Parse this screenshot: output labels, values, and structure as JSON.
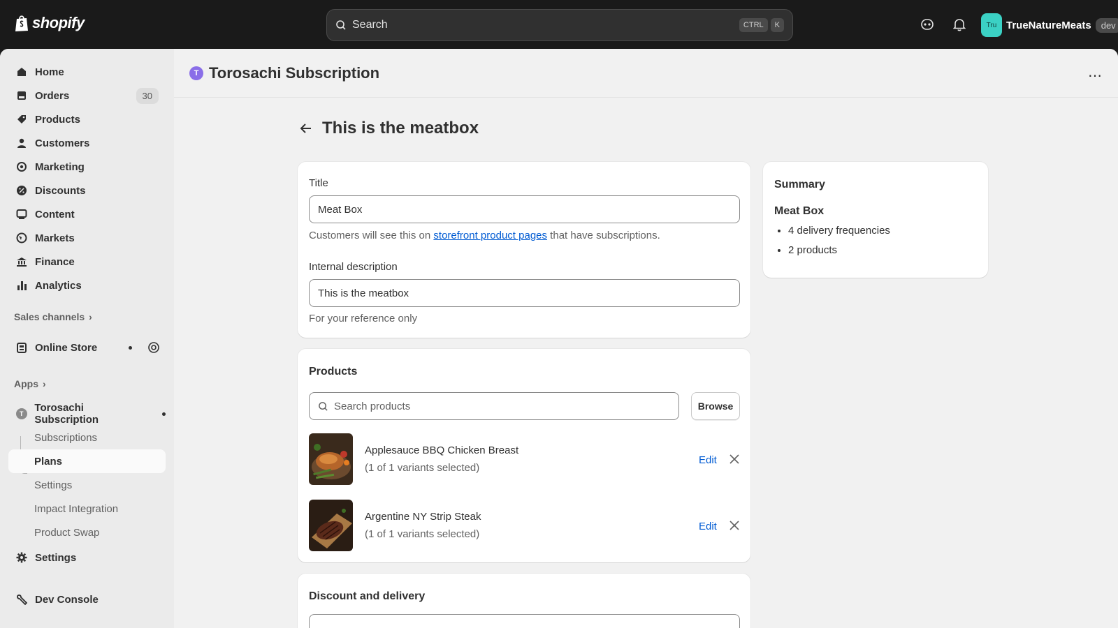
{
  "topbar": {
    "logo_text": "shopify",
    "search_placeholder": "Search",
    "shortcut_ctrl": "CTRL",
    "shortcut_key": "K",
    "avatar_initials": "Tru",
    "store_name": "TrueNatureMeats",
    "env_badge": "dev"
  },
  "sidebar": {
    "items": [
      {
        "label": "Home",
        "icon": "home-icon"
      },
      {
        "label": "Orders",
        "icon": "orders-icon",
        "count": "30"
      },
      {
        "label": "Products",
        "icon": "tag-icon"
      },
      {
        "label": "Customers",
        "icon": "person-icon"
      },
      {
        "label": "Marketing",
        "icon": "target-icon"
      },
      {
        "label": "Discounts",
        "icon": "discount-icon"
      },
      {
        "label": "Content",
        "icon": "content-icon"
      },
      {
        "label": "Markets",
        "icon": "globe-icon"
      },
      {
        "label": "Finance",
        "icon": "bank-icon"
      },
      {
        "label": "Analytics",
        "icon": "bar-chart-icon"
      }
    ],
    "sales_channels_label": "Sales channels",
    "online_store_label": "Online Store",
    "apps_label": "Apps",
    "app_name": "Torosachi Subscription",
    "app_initial": "T",
    "app_sub_items": [
      "Subscriptions",
      "Plans",
      "Settings",
      "Impact Integration",
      "Product Swap"
    ],
    "settings_label": "Settings",
    "dev_console_label": "Dev Console"
  },
  "app_header": {
    "title": "Torosachi Subscription",
    "initial": "T",
    "more_label": "⋯"
  },
  "page": {
    "title": "This is the meatbox",
    "form": {
      "title_label": "Title",
      "title_value": "Meat Box",
      "title_help_prefix": "Customers will see this on ",
      "title_help_link": "storefront product pages",
      "title_help_suffix": " that have subscriptions.",
      "desc_label": "Internal description",
      "desc_value": "This is the meatbox",
      "desc_help": "For your reference only"
    },
    "products": {
      "heading": "Products",
      "search_placeholder": "Search products",
      "browse_label": "Browse",
      "edit_label": "Edit",
      "items": [
        {
          "name": "Applesauce BBQ Chicken Breast",
          "variants": "(1 of 1 variants selected)"
        },
        {
          "name": "Argentine NY Strip Steak",
          "variants": "(1 of 1 variants selected)"
        }
      ]
    },
    "discount": {
      "heading": "Discount and delivery"
    },
    "summary": {
      "heading": "Summary",
      "plan_name": "Meat Box",
      "bullets": [
        "4 delivery frequencies",
        "2 products"
      ]
    }
  },
  "colors": {
    "topbar_bg": "#1a1a1a",
    "link": "#005bd3",
    "avatar_bg": "#3bd1c4",
    "app_badge": "#8a6ee8"
  }
}
